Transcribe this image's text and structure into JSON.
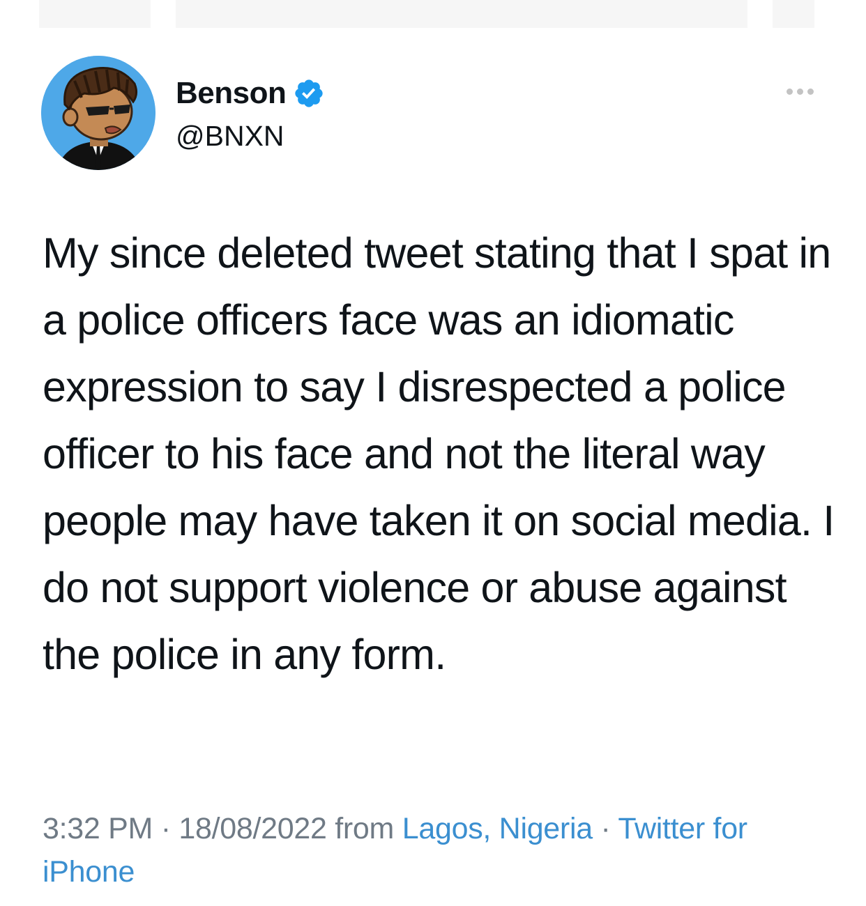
{
  "author": {
    "display_name": "Benson",
    "handle": "@BNXN",
    "verified": true,
    "avatar_icon": "cartoon-avatar",
    "avatar_bg": "#4ea8e8"
  },
  "tweet": {
    "text": "My since deleted tweet stating that I spat in a police officers face was an idiomatic expression to say I disrespected a police officer to his face and not the literal way people may have taken it on social media. I do not support violence or abuse against the police in any form."
  },
  "meta": {
    "time": "3:32 PM",
    "separator": "·",
    "date": "18/08/2022",
    "from_label": "from",
    "location": "Lagos, Nigeria",
    "source": "Twitter for iPhone"
  },
  "colors": {
    "text": "#0f1419",
    "muted": "#6f7a85",
    "link": "#3b8fd0",
    "verified": "#1d9bf0"
  },
  "icons": {
    "more": "more-horizontal-icon",
    "verified": "verified-badge-icon"
  }
}
